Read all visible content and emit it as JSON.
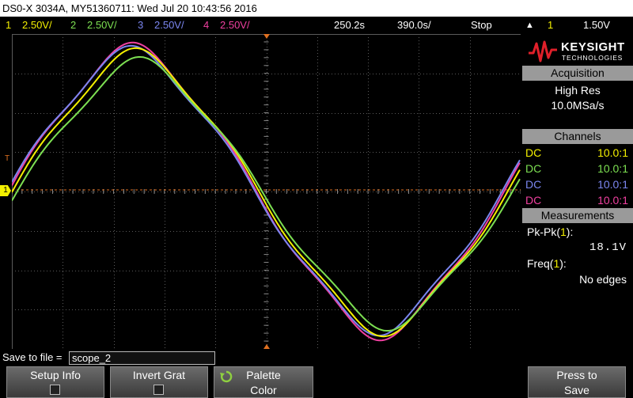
{
  "title": "DS0-X 3034A, MY51360711: Wed Jul 20 10:43:56 2016",
  "status": {
    "ch1": {
      "num": "1",
      "scale": "2.50V/",
      "color": "#f4f000"
    },
    "ch2": {
      "num": "2",
      "scale": "2.50V/",
      "color": "#7de052"
    },
    "ch3": {
      "num": "3",
      "scale": "2.50V/",
      "color": "#7b86f0"
    },
    "ch4": {
      "num": "4",
      "scale": "2.50V/",
      "color": "#f040a0"
    },
    "delay": "250.2s",
    "timebase": "390.0s/",
    "run_state": "Stop",
    "trigger_source": "1",
    "trigger_level": "1.50V"
  },
  "logo": {
    "brand": "KEYSIGHT",
    "sub": "TECHNOLOGIES",
    "color": "#e0202a"
  },
  "acquisition": {
    "header": "Acquisition",
    "mode": "High Res",
    "rate": "10.0MSa/s"
  },
  "channels": {
    "header": "Channels",
    "rows": [
      {
        "coupling": "DC",
        "probe": "10.0:1",
        "color": "#f4f000"
      },
      {
        "coupling": "DC",
        "probe": "10.0:1",
        "color": "#7de052"
      },
      {
        "coupling": "DC",
        "probe": "10.0:1",
        "color": "#7b86f0"
      },
      {
        "coupling": "DC",
        "probe": "10.0:1",
        "color": "#f040a0"
      }
    ]
  },
  "measurements": {
    "header": "Measurements",
    "m1_label": "Pk-Pk(",
    "m1_ch": "1",
    "m1_close": "):",
    "m1_value": "18.1V",
    "m2_label": "Freq(",
    "m2_ch": "1",
    "m2_close": "):",
    "m2_value": "No edges"
  },
  "save": {
    "label": "Save to file =",
    "filename": "scope_2"
  },
  "softkeys": {
    "setup_info": "Setup Info",
    "invert_grat": "Invert Grat",
    "palette_line1": "Palette",
    "palette_line2": "Color",
    "press_to": "Press to",
    "save": "Save"
  },
  "markers": {
    "trigger_letter": "T",
    "ground_marker": "1"
  }
}
